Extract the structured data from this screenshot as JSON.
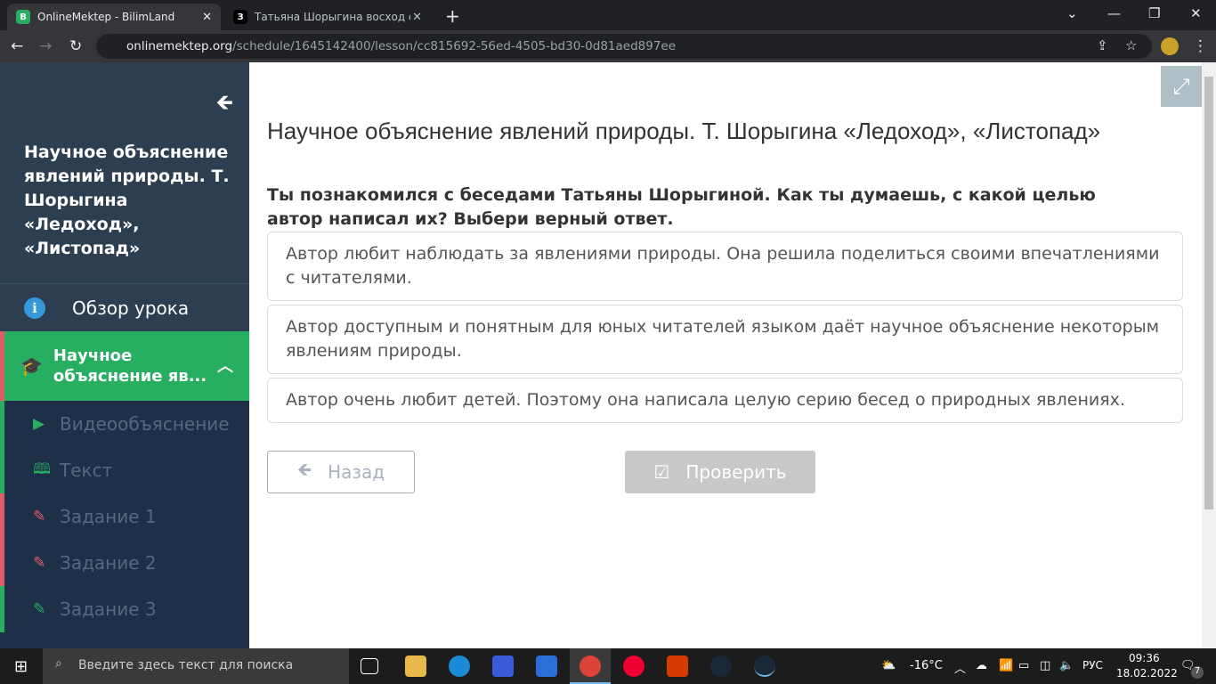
{
  "browser": {
    "tabs": [
      {
        "title": "OnlineMektep - BilimLand",
        "favicon": "B"
      },
      {
        "title": "Татьяна Шорыгина восход солн",
        "favicon": "З"
      }
    ],
    "url_domain": "onlinemektep.org",
    "url_path": "/schedule/1645142400/lesson/cc815692-56ed-4505-bd30-0d81aed897ee"
  },
  "sidebar": {
    "title": "Научное объяснение явлений природы. Т. Шорыгина «Ледоход», «Листопад»",
    "overview": "Обзор урока",
    "current": "Научное объяснение яв...",
    "items": [
      {
        "label": "Видеообъяснение",
        "icon": "play-icon",
        "color": "#27ae60"
      },
      {
        "label": "Текст",
        "icon": "book-icon",
        "color": "#27ae60"
      },
      {
        "label": "Задание 1",
        "icon": "edit-icon",
        "color": "#e05a6a"
      },
      {
        "label": "Задание 2",
        "icon": "edit-icon",
        "color": "#e05a6a"
      },
      {
        "label": "Задание 3",
        "icon": "edit-icon",
        "color": "#27ae60"
      }
    ]
  },
  "main": {
    "title": "Научное объяснение явлений природы. Т. Шорыгина «Ледоход», «Листопад»",
    "question": "Ты познакомился с беседами Татьяны Шорыгиной. Как ты думаешь, с какой целью автор написал их? Выбери верный ответ.",
    "options": [
      "Автор любит наблюдать за явлениями природы. Она решила поделиться своими впечатлениями с читателями.",
      "Автор доступным и понятным для юных читателей языком даёт научное объяснение некоторым явлениям природы.",
      "Автор очень любит детей. Поэтому она написала целую серию бесед о природных явлениях."
    ],
    "back_label": "Назад",
    "check_label": "Проверить"
  },
  "taskbar": {
    "search_placeholder": "Введите здесь текст для поиска",
    "temp": "-16°C",
    "lang": "РУС",
    "time": "09:36",
    "date": "18.02.2022",
    "notifications": "7"
  }
}
